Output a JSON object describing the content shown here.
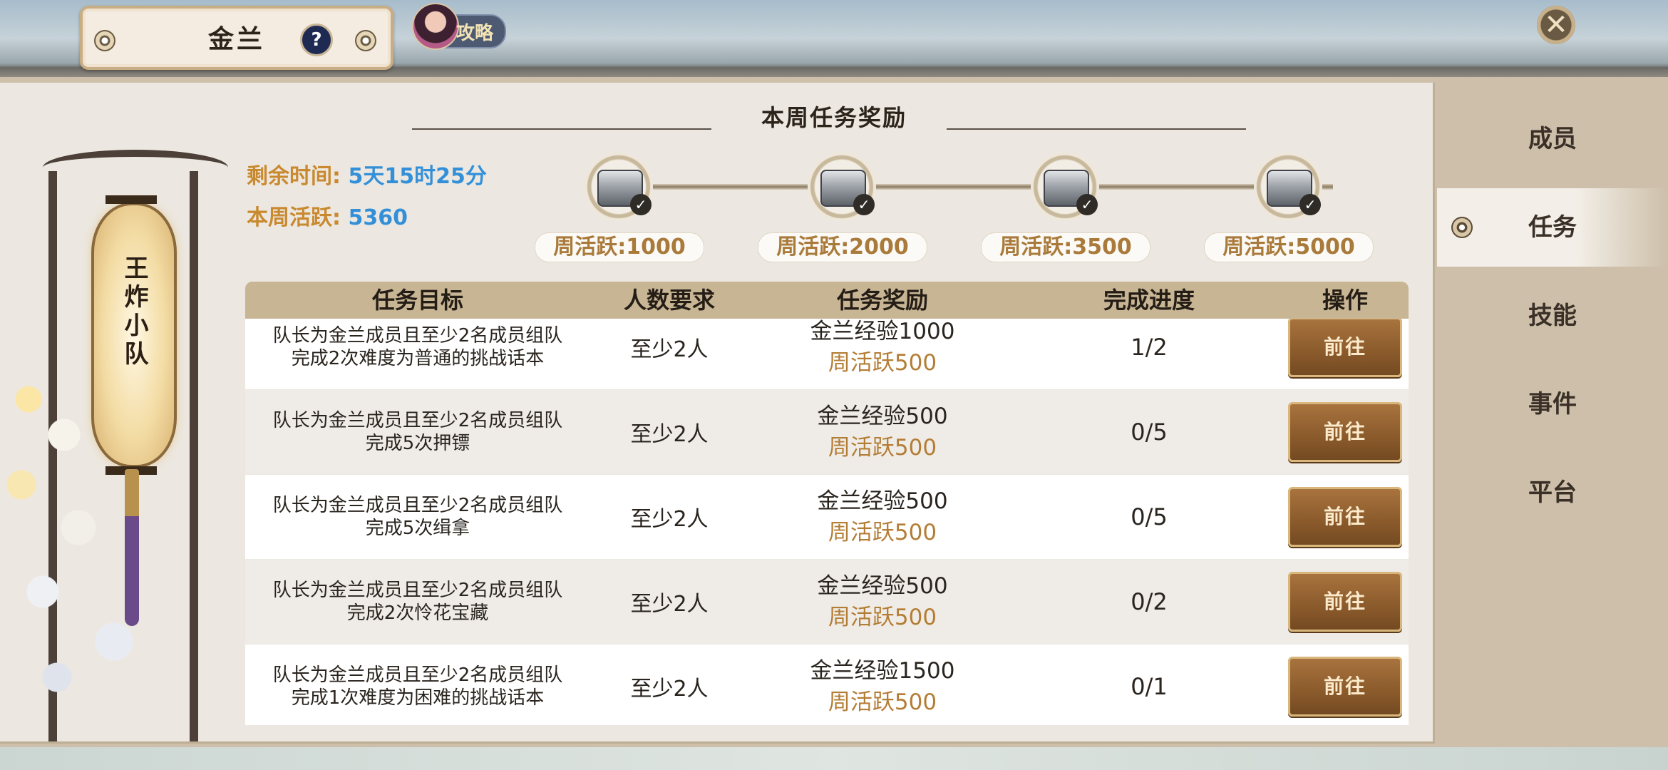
{
  "header": {
    "title": "金兰",
    "help_label": "?",
    "guide_label": "攻略",
    "close_label": "✕"
  },
  "team": {
    "name": "王炸小队"
  },
  "weekly": {
    "section_title": "本周任务奖励",
    "remaining_label": "剩余时间:",
    "remaining_value": "5天15时25分",
    "activity_label": "本周活跃:",
    "activity_value": "5360",
    "milestones": [
      {
        "label": "周活跃:1000",
        "claimed": true,
        "icon": "chest-icon"
      },
      {
        "label": "周活跃:2000",
        "claimed": true,
        "icon": "chest-icon"
      },
      {
        "label": "周活跃:3500",
        "claimed": true,
        "icon": "chest-icon"
      },
      {
        "label": "周活跃:5000",
        "claimed": true,
        "icon": "chest-icon"
      }
    ]
  },
  "table": {
    "headers": [
      "任务目标",
      "人数要求",
      "任务奖励",
      "完成进度",
      "操作"
    ],
    "rows": [
      {
        "goal_line1": "队长为金兰成员且至少2名成员组队",
        "goal_line2": "完成2次难度为普通的挑战话本",
        "people": "至少2人",
        "reward_exp": "金兰经验1000",
        "reward_act": "周活跃500",
        "progress": "1/2",
        "action": "前往"
      },
      {
        "goal_line1": "队长为金兰成员且至少2名成员组队",
        "goal_line2": "完成5次押镖",
        "people": "至少2人",
        "reward_exp": "金兰经验500",
        "reward_act": "周活跃500",
        "progress": "0/5",
        "action": "前往"
      },
      {
        "goal_line1": "队长为金兰成员且至少2名成员组队",
        "goal_line2": "完成5次缉拿",
        "people": "至少2人",
        "reward_exp": "金兰经验500",
        "reward_act": "周活跃500",
        "progress": "0/5",
        "action": "前往"
      },
      {
        "goal_line1": "队长为金兰成员且至少2名成员组队",
        "goal_line2": "完成2次怜花宝藏",
        "people": "至少2人",
        "reward_exp": "金兰经验500",
        "reward_act": "周活跃500",
        "progress": "0/2",
        "action": "前往"
      },
      {
        "goal_line1": "队长为金兰成员且至少2名成员组队",
        "goal_line2": "完成1次难度为困难的挑战话本",
        "people": "至少2人",
        "reward_exp": "金兰经验1500",
        "reward_act": "周活跃500",
        "progress": "0/1",
        "action": "前往"
      }
    ]
  },
  "nav": {
    "items": [
      {
        "label": "成员",
        "active": false
      },
      {
        "label": "任务",
        "active": true
      },
      {
        "label": "技能",
        "active": false
      },
      {
        "label": "事件",
        "active": false
      },
      {
        "label": "平台",
        "active": false
      }
    ]
  },
  "colors": {
    "accent_orange": "#c9892e",
    "value_blue": "#3390d8",
    "button_brown": "#8a5a2b",
    "header_tan": "#c8b594"
  }
}
